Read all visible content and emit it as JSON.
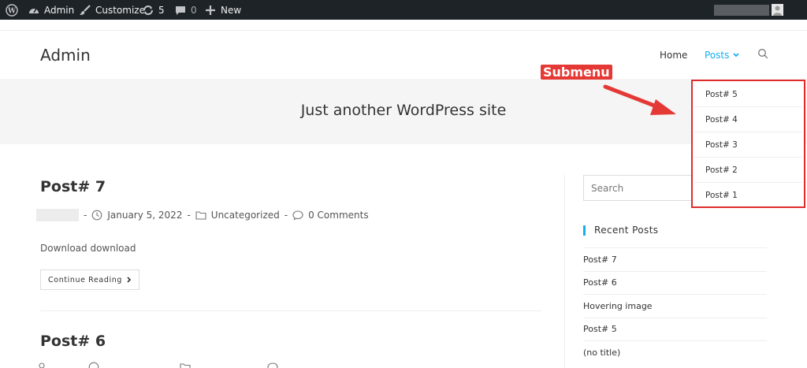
{
  "adminbar": {
    "site_name": "Admin",
    "customize": "Customize",
    "updates_count": "5",
    "comments_count": "0",
    "new": "New"
  },
  "header": {
    "site_title": "Admin",
    "nav": {
      "home": "Home",
      "posts": "Posts"
    }
  },
  "banner": {
    "tagline": "Just another WordPress site"
  },
  "main": {
    "post1": {
      "title": "Post# 7",
      "date": "January 5, 2022",
      "category": "Uncategorized",
      "comments": "0 Comments",
      "excerpt": "Download download",
      "read_more": "Continue Reading"
    },
    "post2": {
      "title": "Post# 6"
    }
  },
  "sidebar": {
    "search_placeholder": "Search",
    "recent_title": "Recent Posts",
    "recent": [
      "Post# 7",
      "Post# 6",
      "Hovering image",
      "Post# 5",
      "(no title)"
    ]
  },
  "submenu": {
    "items": [
      "Post# 5",
      "Post# 4",
      "Post# 3",
      "Post# 2",
      "Post# 1"
    ]
  },
  "annotation": {
    "label": "Submenu",
    "color": "#e53935"
  },
  "colors": {
    "accent": "#13aff0",
    "adminbar": "#1d2327",
    "highlight_border": "#e02b2b"
  }
}
